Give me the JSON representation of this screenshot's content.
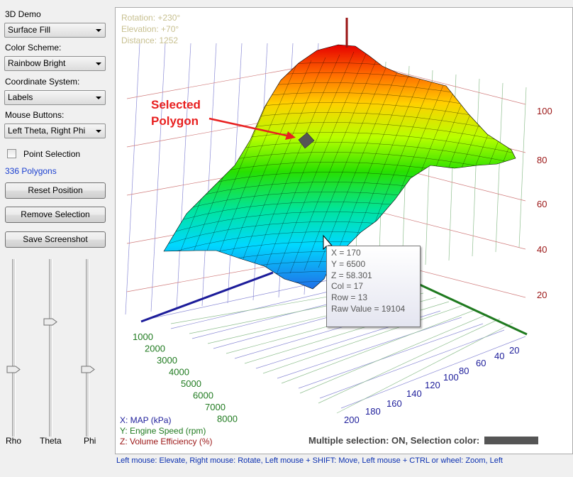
{
  "panel": {
    "demo_label": "3D Demo",
    "demo_value": "Surface Fill",
    "color_label": "Color Scheme:",
    "color_value": "Rainbow Bright",
    "coord_label": "Coordinate System:",
    "coord_value": "Labels",
    "mouse_label": "Mouse Buttons:",
    "mouse_value": "Left Theta, Right Phi",
    "point_selection_label": "Point Selection",
    "polygons_text": "336 Polygons",
    "reset_label": "Reset Position",
    "remove_label": "Remove Selection",
    "save_label": "Save Screenshot"
  },
  "sliders": {
    "rho_label": "Rho",
    "rho_value": 0.62,
    "theta_label": "Theta",
    "theta_value": 0.35,
    "phi_label": "Phi",
    "phi_value": 0.62
  },
  "plot": {
    "rotation": "Rotation:  +230°",
    "elevation": "Elevation: +70°",
    "distance": "Distance:  1252",
    "annotation_line1": "Selected",
    "annotation_line2": "Polygon",
    "z_ticks": [
      "100",
      "80",
      "60",
      "40",
      "20"
    ],
    "y_ticks": [
      "1000",
      "2000",
      "3000",
      "4000",
      "5000",
      "6000",
      "7000",
      "8000"
    ],
    "x_ticks": [
      "20",
      "40",
      "60",
      "80",
      "100",
      "120",
      "140",
      "160",
      "180",
      "200"
    ],
    "legend_x": "X: MAP (kPa)",
    "legend_y": "Y: Engine Speed (rpm)",
    "legend_z": "Z: Volume Efficiency (%)",
    "multi_selection": "Multiple selection: ON, Selection color:",
    "selection_color": "#555555",
    "colors": {
      "x_axis": "#1c1c9a",
      "y_axis": "#1f7a1f",
      "z_axis": "#9a1414"
    }
  },
  "tooltip": {
    "x": "X = 170",
    "y": "Y = 6500",
    "z": "Z = 58.301",
    "col": "Col = 17",
    "row": "Row = 13",
    "raw": "Raw Value = 19104"
  },
  "status": "Left mouse: Elevate,  Right mouse: Rotate,  Left mouse + SHIFT: Move,  Left mouse + CTRL or wheel: Zoom, Left"
}
